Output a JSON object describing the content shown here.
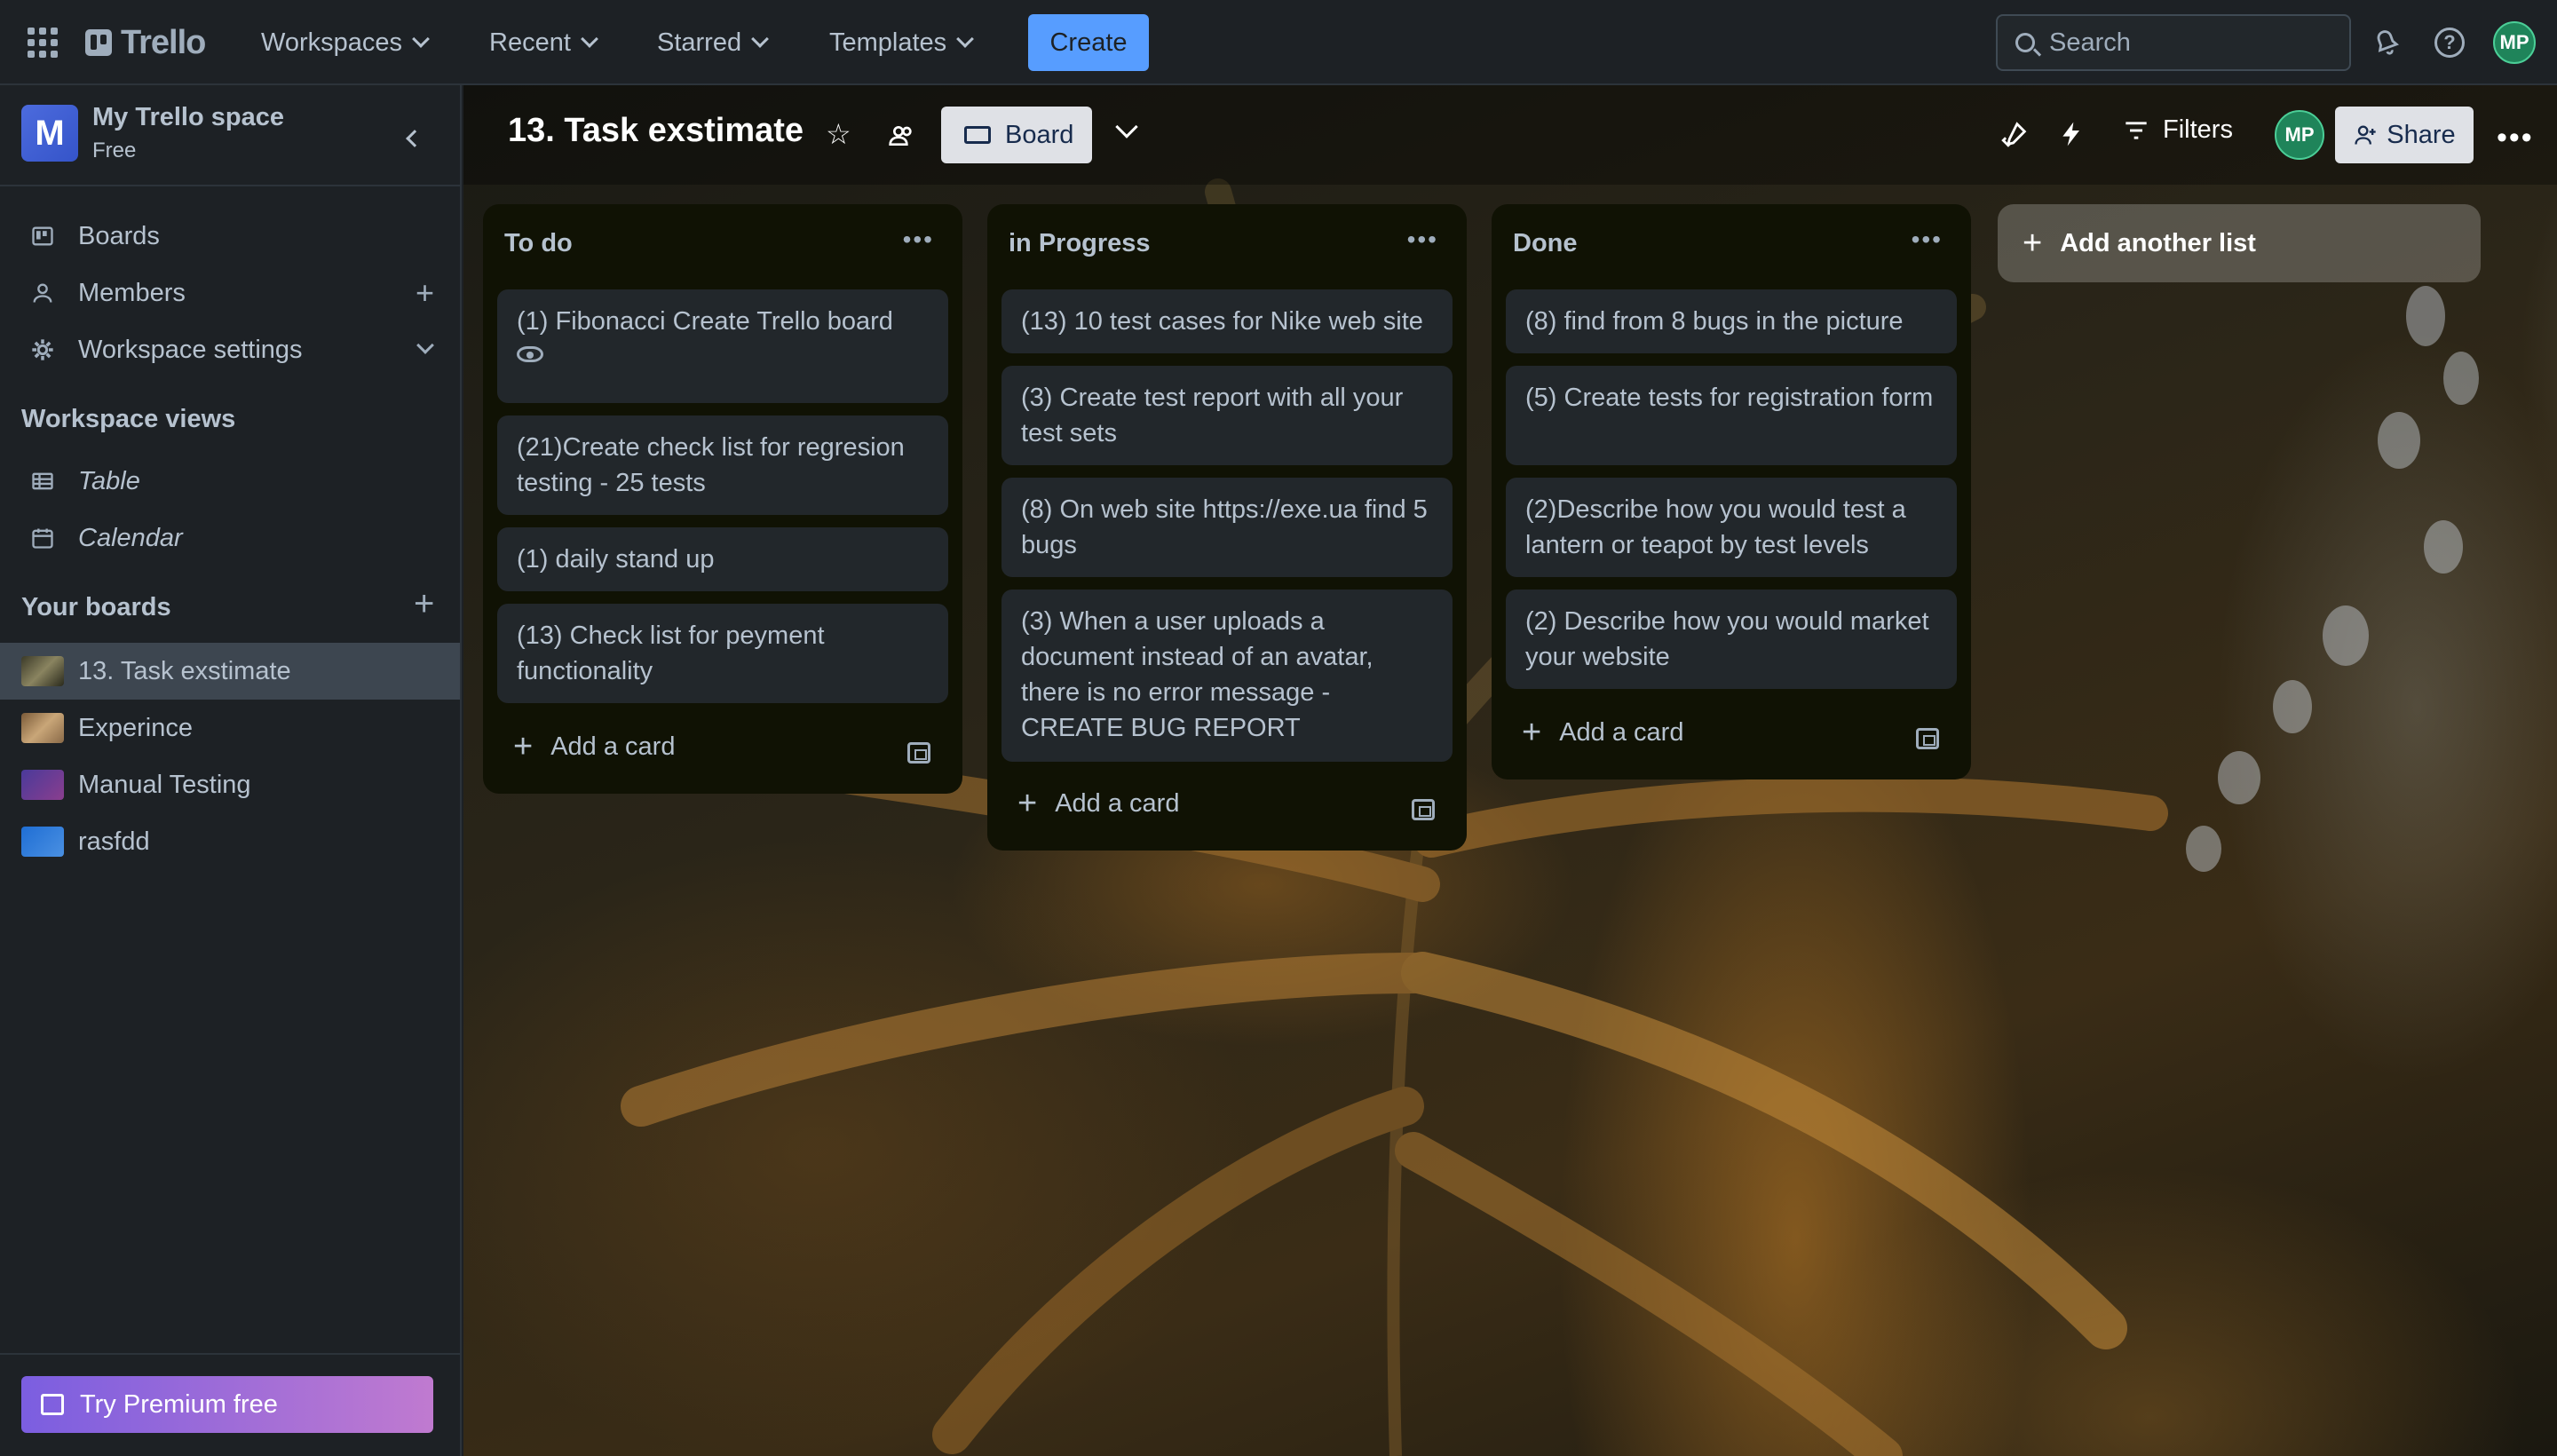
{
  "topnav": {
    "logo_text": "Trello",
    "menus": [
      "Workspaces",
      "Recent",
      "Starred",
      "Templates"
    ],
    "create_label": "Create",
    "search_placeholder": "Search",
    "avatar_initials": "MP"
  },
  "sidebar": {
    "workspace_initial": "M",
    "workspace_name": "My Trello space",
    "workspace_plan": "Free",
    "items": [
      {
        "label": "Boards"
      },
      {
        "label": "Members"
      },
      {
        "label": "Workspace settings"
      }
    ],
    "views_heading": "Workspace views",
    "views": [
      {
        "label": "Table"
      },
      {
        "label": "Calendar"
      }
    ],
    "boards_heading": "Your boards",
    "boards": [
      {
        "label": "13. Task exstimate",
        "color": "#6b6a55",
        "active": true
      },
      {
        "label": "Experince",
        "color": "#b08a5a"
      },
      {
        "label": "Manual Testing",
        "color": "#6a3e8e"
      },
      {
        "label": "rasfdd",
        "color": "#2f7ad6"
      }
    ],
    "premium_label": "Try Premium free"
  },
  "board": {
    "title": "13. Task exstimate",
    "view_label": "Board",
    "filters_label": "Filters",
    "member_initials": "MP",
    "share_label": "Share",
    "add_list_label": "Add another list",
    "add_card_label": "Add a card",
    "lists": [
      {
        "title": "To do",
        "cards": [
          "(1) Fibonacci Create Trello board",
          "(21)Create check list for regresion testing - 25 tests",
          "(1) daily stand up",
          "(13) Check list for peyment functionality"
        ]
      },
      {
        "title": "in Progress",
        "cards": [
          "(13) 10 test cases for Nike web site",
          "(3) Create test report with all your test sets",
          "(8) On web site https://exe.ua find 5 bugs",
          "(3) When a user uploads a document instead of an avatar, there is no error message - CREATE BUG REPORT"
        ]
      },
      {
        "title": "Done",
        "cards": [
          "(8) find from 8 bugs in the picture",
          "(5) Create tests for registration form",
          "(2)Describe how you would test a lantern or teapot by test levels",
          "(2) Describe how you would market your website"
        ]
      }
    ]
  }
}
